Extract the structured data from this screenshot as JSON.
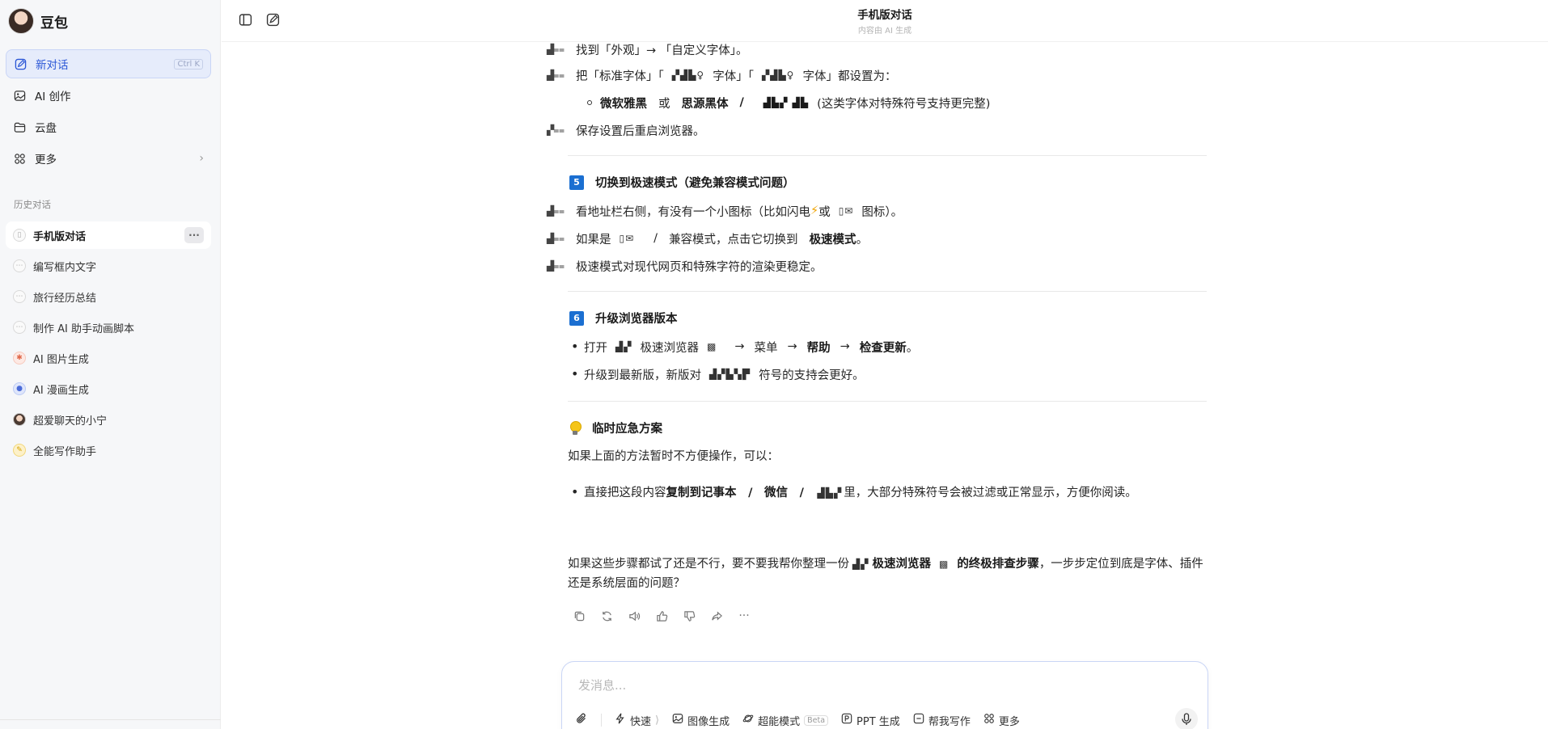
{
  "sidebar": {
    "brand": "豆包",
    "nav": [
      {
        "label": "新对话",
        "shortcut": "Ctrl K"
      },
      {
        "label": "AI 创作"
      },
      {
        "label": "云盘"
      },
      {
        "label": "更多"
      }
    ],
    "history_label": "历史对话",
    "history": [
      {
        "label": "手机版对话",
        "more": "···"
      },
      {
        "label": "编写框内文字"
      },
      {
        "label": "旅行经历总结"
      },
      {
        "label": "制作 AI 助手动画脚本"
      },
      {
        "label": "AI 图片生成"
      },
      {
        "label": "AI 漫画生成"
      },
      {
        "label": "超爱聊天的小宁"
      },
      {
        "label": "全能写作助手"
      }
    ]
  },
  "header": {
    "title": "手机版对话",
    "subtitle": "内容由 AI 生成"
  },
  "content": {
    "r1": {
      "mark": "▟⩵",
      "text": "找到「外观」→ 「自定义字体」。"
    },
    "r2": {
      "mark": "▟⩵",
      "text_a": "把「标准字体」「",
      "sym_a": "▞▟▙♀",
      "text_b": "字体」「",
      "sym_b": "▞▟▙♀",
      "text_c": "字体」都设置为："
    },
    "r2_sub": {
      "b1": "微软雅黑",
      "or": "或",
      "b2": "思源黑体",
      "slash1": "/",
      "sym": "▟▙▞ ▟▙",
      "note": "(这类字体对特殊符号支持更完整)"
    },
    "r3": {
      "mark": "▞⩵",
      "text": "保存设置后重启浏览器。"
    },
    "h5": {
      "num": "5",
      "text": "切换到极速模式（避免兼容模式问题）"
    },
    "r5a": {
      "mark": "▟⩵",
      "text_a": "看地址栏右侧，有没有一个小图标（比如闪电",
      "emoji": "⚡",
      "text_b": "或",
      "sym": "▯✉",
      "text_c": "图标）。"
    },
    "r5b": {
      "mark": "▟⩵",
      "text_a": "如果是",
      "sym": "▯✉",
      "slash": "/",
      "text_b": "兼容模式，点击它切换到",
      "bold": "极速模式",
      "end": "。"
    },
    "r5c": {
      "mark": "▟⩵",
      "text": "极速模式对现代网页和特殊字符的渲染更稳定。"
    },
    "h6": {
      "num": "6",
      "text": "升级浏览器版本"
    },
    "b6a": {
      "t1": "打开",
      "sym": "▟▞",
      "t2": "极速浏览器",
      "sym2": "▩",
      "arrow1": "→",
      "t3": "菜单",
      "arrow2": "→",
      "b1": "帮助",
      "arrow3": "→",
      "b2": "检查更新",
      "end": "。"
    },
    "b6b": {
      "t1": "升级到最新版，新版对",
      "sym": "▟▞▙▚▛",
      "t2": "符号的支持会更好。"
    },
    "h_tip": {
      "text": "临时应急方案"
    },
    "p_tip": "如果上面的方法暂时不方便操作，可以：",
    "b_tip": {
      "t1": "直接把这段内容",
      "b1": "复制到记事本",
      "s1": "/",
      "b2": "微信",
      "s2": "/",
      "sym": "▟▙▞",
      "t2": "里，大部分特殊符号会被过滤或正常显示，方便你阅读。"
    },
    "final": {
      "t1": "如果这些步骤都试了还是不行，要不要我帮你整理一份",
      "sym": "▟▞",
      "b1": "极速浏览器",
      "sym2": "▩",
      "b2": "的终极排查步骤",
      "t2": "，一步步定位到底是字体、插件还是系统层面的问题？"
    }
  },
  "actions": [
    "copy-icon",
    "regenerate-icon",
    "speaker-icon",
    "thumbs-up-icon",
    "thumbs-down-icon",
    "share-icon",
    "more-icon"
  ],
  "composer": {
    "placeholder": "发消息...",
    "tools": [
      {
        "label": "快速"
      },
      {
        "label": "图像生成"
      },
      {
        "label": "超能模式",
        "badge": "Beta"
      },
      {
        "label": "PPT 生成"
      },
      {
        "label": "帮我写作"
      },
      {
        "label": "更多"
      }
    ]
  },
  "colors": {
    "accent": "#2a56d6",
    "number_badge": "#1b6fd1",
    "sidebar_bg": "#f6f7f9"
  }
}
